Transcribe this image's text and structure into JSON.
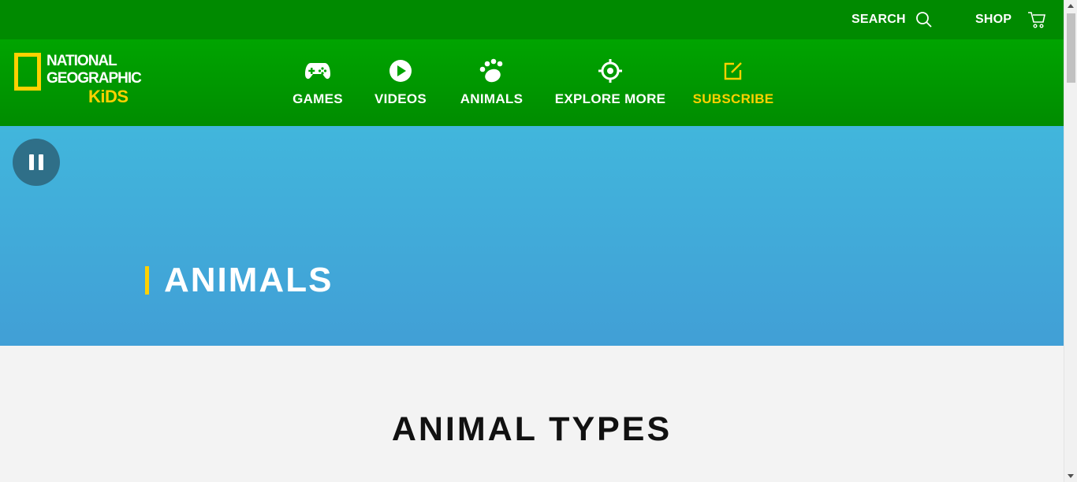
{
  "topbar": {
    "search_label": "SEARCH",
    "search_icon": "search-icon",
    "shop_label": "SHOP",
    "cart_icon": "cart-icon"
  },
  "logo": {
    "line1": "NATIONAL",
    "line2": "GEOGRAPHIC",
    "line3": "KiDS"
  },
  "nav": {
    "games": {
      "label": "GAMES",
      "icon": "gamepad-icon"
    },
    "videos": {
      "label": "VIDEOS",
      "icon": "play-icon"
    },
    "animals": {
      "label": "ANIMALS",
      "icon": "paw-icon"
    },
    "explore": {
      "label": "EXPLORE MORE",
      "icon": "target-icon"
    },
    "subscribe": {
      "label": "SUBSCRIBE",
      "icon": "edit-icon"
    }
  },
  "hero": {
    "title": "ANIMALS",
    "pause_icon": "pause-icon"
  },
  "main": {
    "section_title": "ANIMAL TYPES"
  },
  "colors": {
    "topbar": "#008a00",
    "nav": "#00a400",
    "accent_yellow": "#ffd100",
    "hero_blue": "#41b6dc",
    "pause_bg": "#2f6f88",
    "page_bg": "#f3f3f3"
  }
}
